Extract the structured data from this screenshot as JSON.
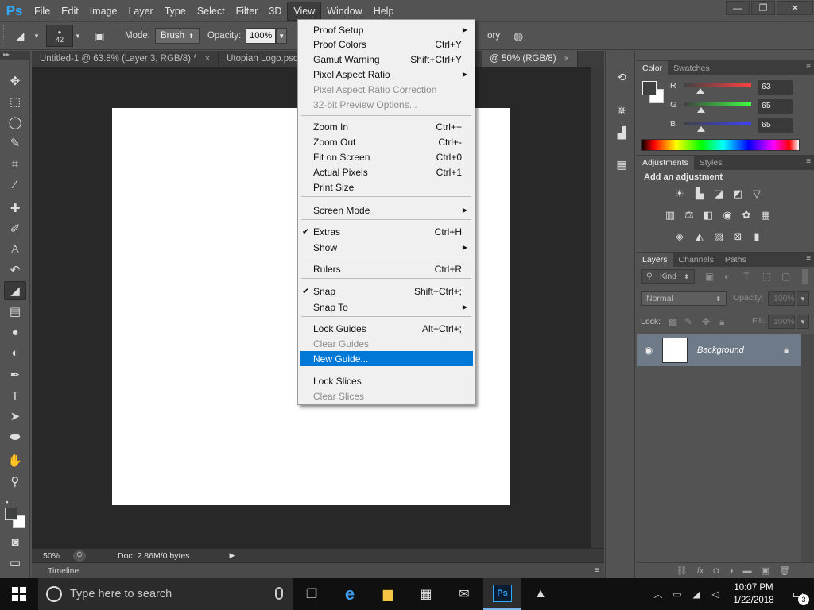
{
  "app": {
    "logo": "Ps"
  },
  "menubar": {
    "items": [
      "File",
      "Edit",
      "Image",
      "Layer",
      "Type",
      "Select",
      "Filter",
      "3D",
      "View",
      "Window",
      "Help"
    ],
    "open_item": "View"
  },
  "window_controls": {
    "minimize": "—",
    "restore": "❐",
    "close": "✕"
  },
  "options_bar": {
    "brush_size": "42",
    "mode_label": "Mode:",
    "mode_value": "Brush",
    "opacity_label": "Opacity:",
    "opacity_value": "100%",
    "history_partial": "ory"
  },
  "doc_tabs": [
    {
      "label": "Untitled-1 @ 63.8% (Layer 3, RGB/8) *",
      "close": "×"
    },
    {
      "label": "Utopian Logo.psd",
      "close": ""
    },
    {
      "label": "@ 50% (RGB/8)",
      "close": "×"
    }
  ],
  "status": {
    "zoom": "50%",
    "doc_info": "Doc: 2.86M/0 bytes"
  },
  "timeline": {
    "label": "Timeline"
  },
  "color_panel": {
    "tabs": [
      "Color",
      "Swatches"
    ],
    "channels": [
      {
        "label": "R",
        "value": "63",
        "level": 0.247,
        "gradient": "linear-gradient(to right,#3f4141,#ff4141)"
      },
      {
        "label": "G",
        "value": "65",
        "level": 0.255,
        "gradient": "linear-gradient(to right,#3f4141,#3fff41)"
      },
      {
        "label": "B",
        "value": "65",
        "level": 0.255,
        "gradient": "linear-gradient(to right,#3f4141,#3f41ff)"
      }
    ]
  },
  "adjustments_panel": {
    "tabs": [
      "Adjustments",
      "Styles"
    ],
    "title": "Add an adjustment"
  },
  "layers_panel": {
    "tabs": [
      "Layers",
      "Channels",
      "Paths"
    ],
    "kind_label": "Kind",
    "blend_mode": "Normal",
    "opacity_label": "Opacity:",
    "opacity_value": "100%",
    "lock_label": "Lock:",
    "fill_label": "Fill:",
    "fill_value": "100%",
    "layer_name": "Background"
  },
  "view_menu": {
    "items": [
      {
        "label": "Proof Setup",
        "shortcut": "",
        "submenu": true
      },
      {
        "label": "Proof Colors",
        "shortcut": "Ctrl+Y"
      },
      {
        "label": "Gamut Warning",
        "shortcut": "Shift+Ctrl+Y"
      },
      {
        "label": "Pixel Aspect Ratio",
        "shortcut": "",
        "submenu": true
      },
      {
        "label": "Pixel Aspect Ratio Correction",
        "shortcut": "",
        "disabled": true
      },
      {
        "label": "32-bit Preview Options...",
        "shortcut": "",
        "disabled": true
      },
      {
        "label": "Zoom In",
        "shortcut": "Ctrl++"
      },
      {
        "label": "Zoom Out",
        "shortcut": "Ctrl+-"
      },
      {
        "label": "Fit on Screen",
        "shortcut": "Ctrl+0"
      },
      {
        "label": "Actual Pixels",
        "shortcut": "Ctrl+1"
      },
      {
        "label": "Print Size",
        "shortcut": ""
      },
      {
        "label": "Screen Mode",
        "shortcut": "",
        "submenu": true
      },
      {
        "label": "Extras",
        "shortcut": "Ctrl+H",
        "checked": true
      },
      {
        "label": "Show",
        "shortcut": "",
        "submenu": true
      },
      {
        "label": "Rulers",
        "shortcut": "Ctrl+R"
      },
      {
        "label": "Snap",
        "shortcut": "Shift+Ctrl+;",
        "checked": true
      },
      {
        "label": "Snap To",
        "shortcut": "",
        "submenu": true
      },
      {
        "label": "Lock Guides",
        "shortcut": "Alt+Ctrl+;"
      },
      {
        "label": "Clear Guides",
        "shortcut": "",
        "disabled": true
      },
      {
        "label": "New Guide...",
        "shortcut": "",
        "highlighted": true
      },
      {
        "label": "Lock Slices",
        "shortcut": ""
      },
      {
        "label": "Clear Slices",
        "shortcut": "",
        "disabled": true
      }
    ]
  },
  "taskbar": {
    "search_placeholder": "Type here to search",
    "time": "10:07 PM",
    "date": "1/22/2018",
    "notifications": "3"
  },
  "colors": {
    "highlight": "#0078d7",
    "ps_blue": "#31a8ff",
    "layer_selected": "#6f7a88"
  }
}
